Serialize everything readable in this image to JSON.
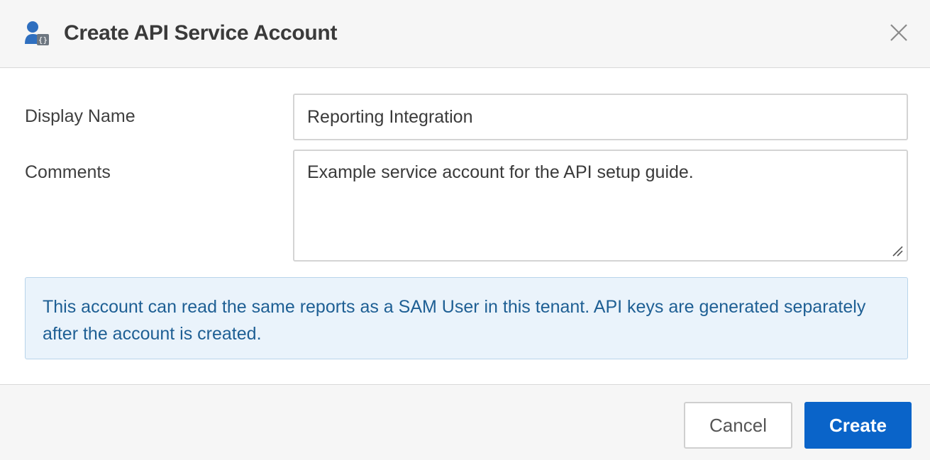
{
  "dialog": {
    "title": "Create API Service Account",
    "header_icon": "api-user-icon",
    "close_icon": "close-icon"
  },
  "form": {
    "display_name": {
      "label": "Display Name",
      "value": "Reporting Integration"
    },
    "comments": {
      "label": "Comments",
      "value": "Example service account for the API setup guide."
    }
  },
  "info": {
    "text": "This account can read the same reports as a SAM User in this tenant. API keys are generated separately after the account is created."
  },
  "footer": {
    "cancel_label": "Cancel",
    "create_label": "Create"
  },
  "colors": {
    "primary": "#0a64c9",
    "info_background": "#eaf3fb",
    "info_text": "#1e5f94",
    "header_background": "#f6f6f6"
  }
}
